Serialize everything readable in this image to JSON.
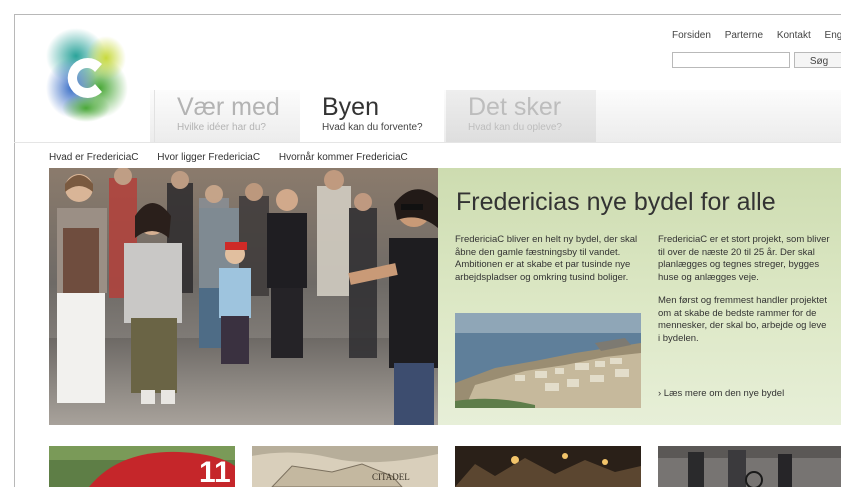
{
  "top_nav": {
    "items": [
      "Forsiden",
      "Parterne",
      "Kontakt",
      "English"
    ]
  },
  "search": {
    "placeholder": "",
    "button_label": "Søg"
  },
  "tabs": [
    {
      "title": "Vær med",
      "subtitle": "Hvilke idéer har du?",
      "active": false
    },
    {
      "title": "Byen",
      "subtitle": "Hvad kan du forvente?",
      "active": true
    },
    {
      "title": "Det sker",
      "subtitle": "Hvad kan du opleve?",
      "active": false
    }
  ],
  "sub_nav": {
    "items": [
      "Hvad er FredericiaC",
      "Hvor ligger FredericiaC",
      "Hvornår kommer FredericiaC"
    ]
  },
  "hero": {
    "title": "Fredericias nye bydel for alle",
    "col1_text": "FredericiaC bliver en helt ny bydel, der skal åbne den gamle fæstningsby til vandet. Ambitionen er at skabe et par tusinde nye arbejdspladser og omkring tusind boliger.",
    "col2_p1": "FredericiaC er et stort projekt, som bliver til over de næste 20 til 25 år. Der skal planlægges og tegnes streger, bygges huse og anlægges veje.",
    "col2_p2": "Men først og fremmest handler projektet om at skabe de bedste rammer for de mennesker, der skal bo, arbejde og leve i bydelen.",
    "read_more": "› Læs mere om den nye bydel"
  },
  "thumbnails": {
    "map_label": "CITADEL",
    "jersey_number": "11"
  },
  "colors": {
    "panel_green": "#d5e2bd",
    "text": "#333333",
    "tab_inactive": "#b3b3b3"
  }
}
